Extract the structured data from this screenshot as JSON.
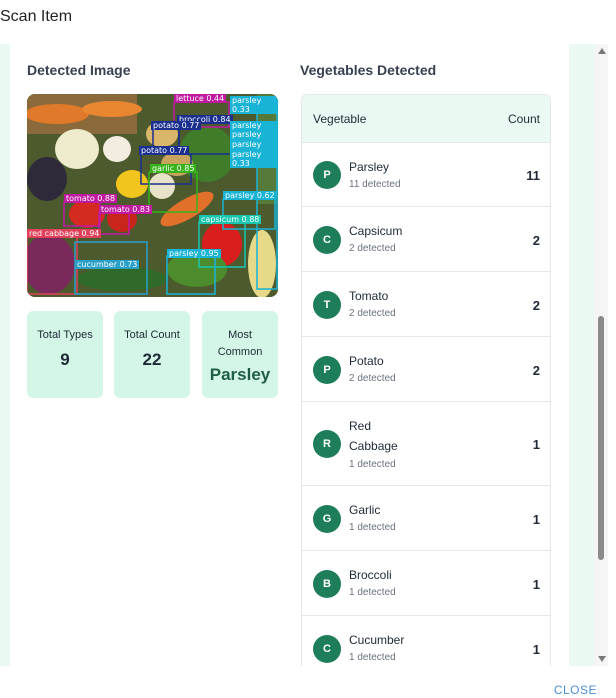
{
  "dialog": {
    "title": "Scan Item",
    "close_label": "CLOSE"
  },
  "detected_image": {
    "title": "Detected Image",
    "boxes": [
      {
        "label": "lettuce 0.44",
        "color": "#c01aa0"
      },
      {
        "label": "parsley 0.33",
        "color": "#19b3d6"
      },
      {
        "label": "broccoli 0.84",
        "color": "#1a2f8f"
      },
      {
        "label": "potato 0.77",
        "color": "#1a2f8f"
      },
      {
        "label": "parsley 0.67",
        "color": "#19b3d6"
      },
      {
        "label": "parsley 0.50",
        "color": "#19b3d6"
      },
      {
        "label": "potato 0.77",
        "color": "#1a2f8f"
      },
      {
        "label": "parsley 0.32",
        "color": "#19b3d6"
      },
      {
        "label": "parsley 0.33",
        "color": "#19b3d6"
      },
      {
        "label": "garlic 0.85",
        "color": "#37b31a"
      },
      {
        "label": "parsley 0.62",
        "color": "#19b3d6"
      },
      {
        "label": "tomato 0.88",
        "color": "#c01aa0"
      },
      {
        "label": "tomato 0.83",
        "color": "#c01aa0"
      },
      {
        "label": "capsicum 0.88",
        "color": "#19c6b0"
      },
      {
        "label": "red cabbage 0.94",
        "color": "#e0405a"
      },
      {
        "label": "cucumber 0.73",
        "color": "#2a9fc8"
      },
      {
        "label": "parsley 0.95",
        "color": "#19b3d6"
      }
    ]
  },
  "stats": {
    "total_types_label": "Total Types",
    "total_types_value": "9",
    "total_count_label": "Total Count",
    "total_count_value": "22",
    "most_common_label": "Most Common",
    "most_common_value": "Parsley"
  },
  "vegetables": {
    "title": "Vegetables Detected",
    "header_vegetable": "Vegetable",
    "header_count": "Count",
    "rows": [
      {
        "initial": "P",
        "name": "Parsley",
        "sub": "11 detected",
        "count": "11"
      },
      {
        "initial": "C",
        "name": "Capsicum",
        "sub": "2 detected",
        "count": "2"
      },
      {
        "initial": "T",
        "name": "Tomato",
        "sub": "2 detected",
        "count": "2"
      },
      {
        "initial": "P",
        "name": "Potato",
        "sub": "2 detected",
        "count": "2"
      },
      {
        "initial": "R",
        "name": "Red Cabbage",
        "sub": "1 detected",
        "count": "1"
      },
      {
        "initial": "G",
        "name": "Garlic",
        "sub": "1 detected",
        "count": "1"
      },
      {
        "initial": "B",
        "name": "Broccoli",
        "sub": "1 detected",
        "count": "1"
      },
      {
        "initial": "C",
        "name": "Cucumber",
        "sub": "1 detected",
        "count": "1"
      }
    ]
  },
  "colors": {
    "accent": "#1e7e5a",
    "stat_bg": "#d4f6e6",
    "panel_tint": "#eafaf3",
    "link": "#4a8ed6"
  }
}
